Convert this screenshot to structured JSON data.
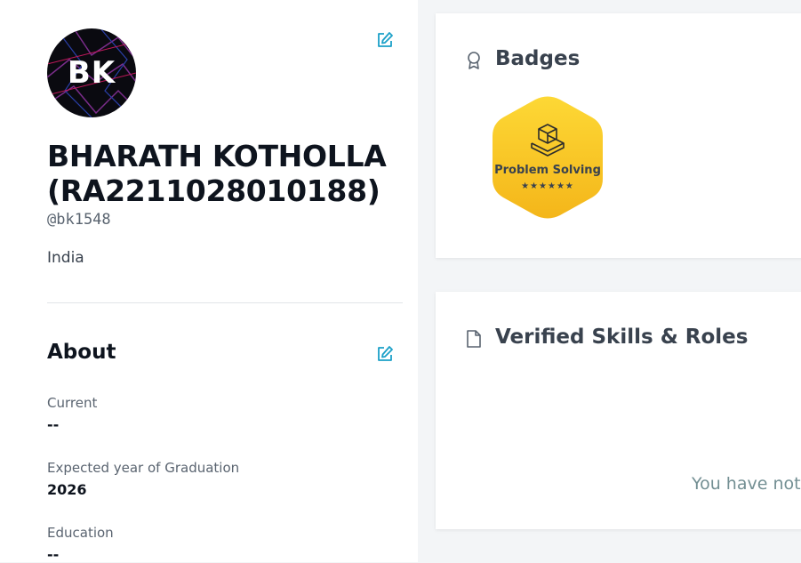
{
  "profile": {
    "avatar_initials": "BK",
    "name": "BHARATH KOTHOLLA (RA2211028010188)",
    "handle": "@bk1548",
    "country": "India"
  },
  "about": {
    "title": "About",
    "fields": [
      {
        "label": "Current",
        "value": "--"
      },
      {
        "label": "Expected year of Graduation",
        "value": "2026"
      },
      {
        "label": "Education",
        "value": "--"
      }
    ]
  },
  "badges": {
    "title": "Badges",
    "items": [
      {
        "label": "Problem Solving",
        "stars": "★★★★★★",
        "color": "#f5c518"
      }
    ]
  },
  "skills": {
    "title": "Verified Skills & Roles",
    "empty_message": "You have not"
  },
  "colors": {
    "accent": "#1ba0c8",
    "badge_gold": "#f5c518"
  },
  "icons": {
    "edit": "edit-icon",
    "badge": "ribbon-icon",
    "document": "document-icon"
  }
}
